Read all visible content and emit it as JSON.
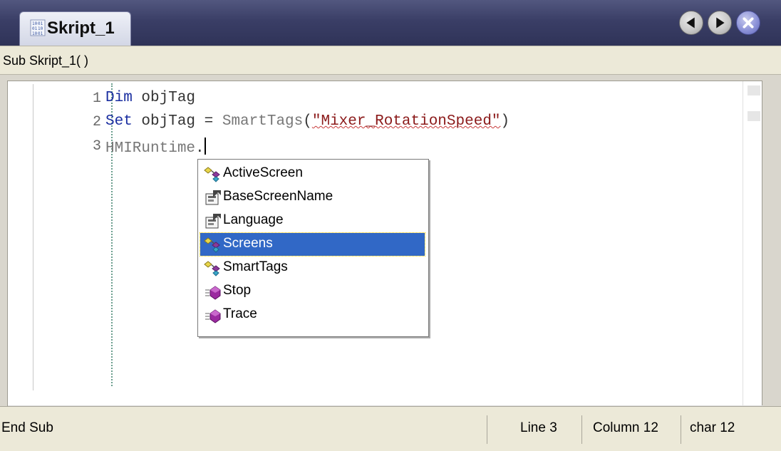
{
  "tab": {
    "title": "Skript_1",
    "icon": "script-file-icon"
  },
  "nav": {
    "back_icon": "arrow-left-icon",
    "forward_icon": "arrow-right-icon",
    "close_icon": "close-icon"
  },
  "procedure": {
    "label": "Sub Skript_1( )"
  },
  "editor": {
    "lines": [
      {
        "num": "1",
        "kw": "Dim",
        "rest": " objTag"
      },
      {
        "num": "2",
        "kw": "Set",
        "mid": " objTag = ",
        "fn": "SmartTags",
        "open": "(",
        "str": "\"Mixer_RotationSpeed\"",
        "close": ")"
      },
      {
        "num": "3",
        "fn": "HMIRuntime",
        "rest": "."
      }
    ]
  },
  "autocomplete": {
    "items": [
      {
        "label": "ActiveScreen",
        "icon": "object-property-icon",
        "selected": false
      },
      {
        "label": "BaseScreenName",
        "icon": "property-icon",
        "selected": false
      },
      {
        "label": "Language",
        "icon": "property-icon",
        "selected": false
      },
      {
        "label": "Screens",
        "icon": "object-property-icon",
        "selected": true
      },
      {
        "label": "SmartTags",
        "icon": "object-property-icon",
        "selected": false
      },
      {
        "label": "Stop",
        "icon": "method-icon",
        "selected": false
      },
      {
        "label": "Trace",
        "icon": "method-icon",
        "selected": false
      }
    ]
  },
  "status": {
    "left": "End Sub",
    "line": "Line 3",
    "column": "Column 12",
    "char": "char 12"
  },
  "colors": {
    "selection": "#3168c6",
    "keyword": "#1a2ea0",
    "string": "#8b1a1a",
    "titlebar": "#3a3e66"
  }
}
